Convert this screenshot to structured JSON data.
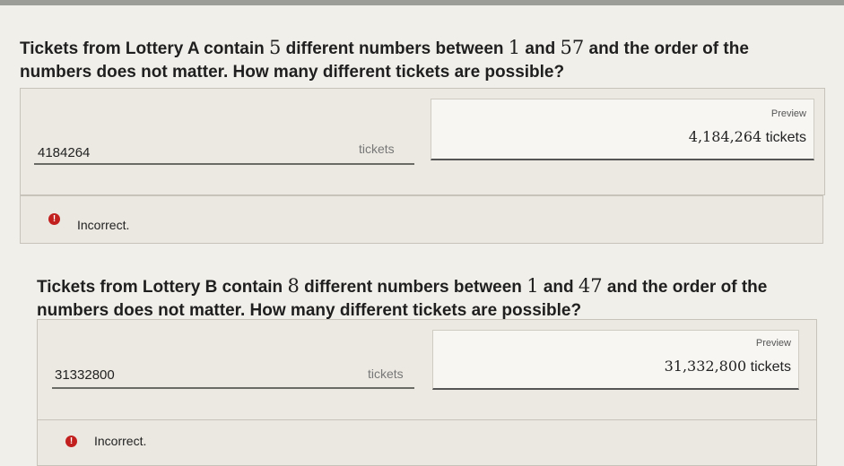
{
  "questions": [
    {
      "text_before": "Tickets from Lottery A contain ",
      "n": "5",
      "text_mid": " different numbers between ",
      "low": "1",
      "text_and": " and ",
      "high": "57",
      "text_after_line1": " and the order of the",
      "line2": "numbers does not matter. How many different tickets are possible?",
      "answer": "4184264",
      "unit": "tickets",
      "preview_label": "Preview",
      "preview_number": "4,184,264",
      "preview_unit": " tickets",
      "feedback": "Incorrect."
    },
    {
      "text_before": "Tickets from Lottery B contain ",
      "n": "8",
      "text_mid": " different numbers between ",
      "low": "1",
      "text_and": " and ",
      "high": "47",
      "text_after_line1": " and the order of the",
      "line2": "numbers does not matter. How many different tickets are possible?",
      "answer": "31332800",
      "unit": "tickets",
      "preview_label": "Preview",
      "preview_number": "31,332,800",
      "preview_unit": " tickets",
      "feedback": "Incorrect."
    }
  ],
  "colors": {
    "error": "#c21f1f",
    "background": "#f1efe9"
  },
  "icons": {
    "error": "exclamation-circle-icon"
  },
  "icon_glyph": "!"
}
